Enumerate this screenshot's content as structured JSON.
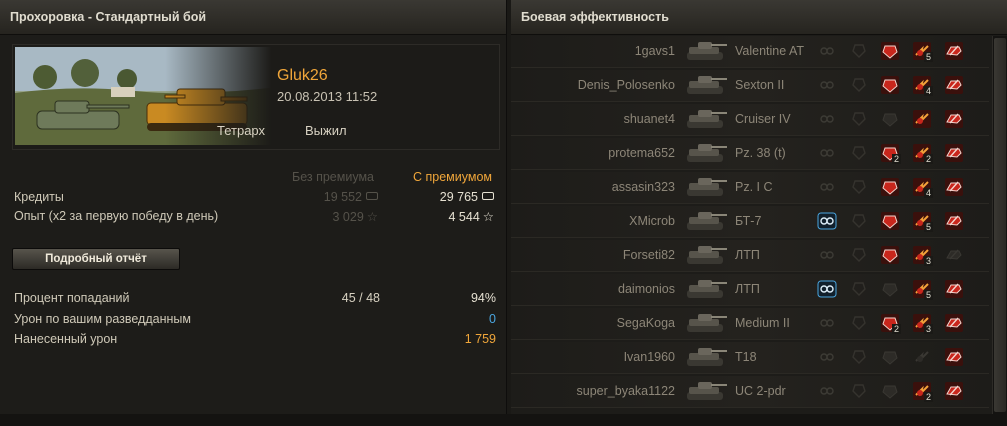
{
  "left": {
    "header": "Прохоровка - Стандартный бой",
    "player_name": "Gluk26",
    "date": "20.08.2013 11:52",
    "vehicle": "Тетрарх",
    "status": "Выжил",
    "col_no_premium": "Без премиума",
    "col_premium": "С премиумом",
    "credits_label": "Кредиты",
    "credits_base": "19 552",
    "credits_premium": "29 765",
    "xp_label": "Опыт (x2 за первую победу в день)",
    "xp_base": "3 029",
    "xp_premium": "4 544",
    "detail_button": "Подробный отчёт",
    "hit_label": "Процент попаданий",
    "hits": "45 / 48",
    "hit_percent": "94%",
    "spot_damage_label": "Урон по вашим разведданным",
    "spot_damage": "0",
    "damage_label": "Нанесенный урон",
    "damage": "1 759"
  },
  "right": {
    "header": "Боевая эффективность",
    "rows": [
      {
        "player": "1gavs1",
        "tank": "Valentine AT",
        "spot": false,
        "crit": true,
        "crit_count": "",
        "dmg": true,
        "dmg_count": "5",
        "kill": true
      },
      {
        "player": "Denis_Polosenko",
        "tank": "Sexton II",
        "spot": false,
        "crit": true,
        "crit_count": "",
        "dmg": true,
        "dmg_count": "4",
        "kill": true
      },
      {
        "player": "shuanet4",
        "tank": "Cruiser IV",
        "spot": false,
        "crit": false,
        "crit_count": "",
        "dmg": true,
        "dmg_count": "",
        "kill": true
      },
      {
        "player": "protema652",
        "tank": "Pz. 38 (t)",
        "spot": false,
        "crit": true,
        "crit_count": "2",
        "dmg": true,
        "dmg_count": "2",
        "kill": true
      },
      {
        "player": "assasin323",
        "tank": "Pz. I C",
        "spot": false,
        "crit": true,
        "crit_count": "",
        "dmg": true,
        "dmg_count": "4",
        "kill": true
      },
      {
        "player": "XMicrob",
        "tank": "БТ-7",
        "spot": true,
        "crit": true,
        "crit_count": "",
        "dmg": true,
        "dmg_count": "5",
        "kill": true
      },
      {
        "player": "Forseti82",
        "tank": "ЛТП",
        "spot": false,
        "crit": true,
        "crit_count": "",
        "dmg": true,
        "dmg_count": "3",
        "kill": false
      },
      {
        "player": "daimonios",
        "tank": "ЛТП",
        "spot": true,
        "crit": false,
        "crit_count": "",
        "dmg": true,
        "dmg_count": "5",
        "kill": true
      },
      {
        "player": "SegaKoga",
        "tank": "Medium II",
        "spot": false,
        "crit": true,
        "crit_count": "2",
        "dmg": true,
        "dmg_count": "3",
        "kill": true
      },
      {
        "player": "Ivan1960",
        "tank": "T18",
        "spot": false,
        "crit": false,
        "crit_count": "",
        "dmg": false,
        "dmg_count": "",
        "kill": true
      },
      {
        "player": "super_byaka1122",
        "tank": "UC 2-pdr",
        "spot": false,
        "crit": false,
        "crit_count": "",
        "dmg": true,
        "dmg_count": "2",
        "kill": true
      }
    ]
  },
  "colors": {
    "accent_orange": "#f0a63a",
    "spot_blue": "#4aa6e0",
    "icon_red": "#c8261c"
  }
}
